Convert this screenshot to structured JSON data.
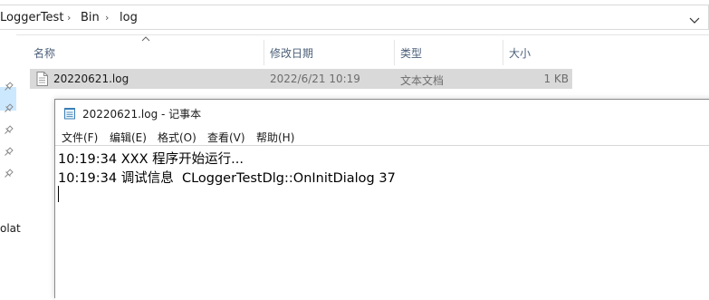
{
  "explorer": {
    "breadcrumb": [
      "LoggerTest",
      "Bin",
      "log"
    ],
    "breadcrumb_separator": "›",
    "nav_partial_label": "olat",
    "columns": {
      "name": "名称",
      "modified": "修改日期",
      "type": "类型",
      "size": "大小"
    },
    "files": [
      {
        "name": "20220621.log",
        "modified": "2022/6/21 10:19",
        "type": "文本文档",
        "size": "1 KB"
      }
    ],
    "selected_row_color": "#d9d9d9",
    "nav_selected_color": "#cce8ff"
  },
  "notepad": {
    "title": "20220621.log - 记事本",
    "menu": [
      "文件(F)",
      "编辑(E)",
      "格式(O)",
      "查看(V)",
      "帮助(H)"
    ],
    "lines": [
      "10:19:34 XXX 程序开始运行...",
      "10:19:34 调试信息  CLoggerTestDlg::OnInitDialog 37"
    ]
  }
}
